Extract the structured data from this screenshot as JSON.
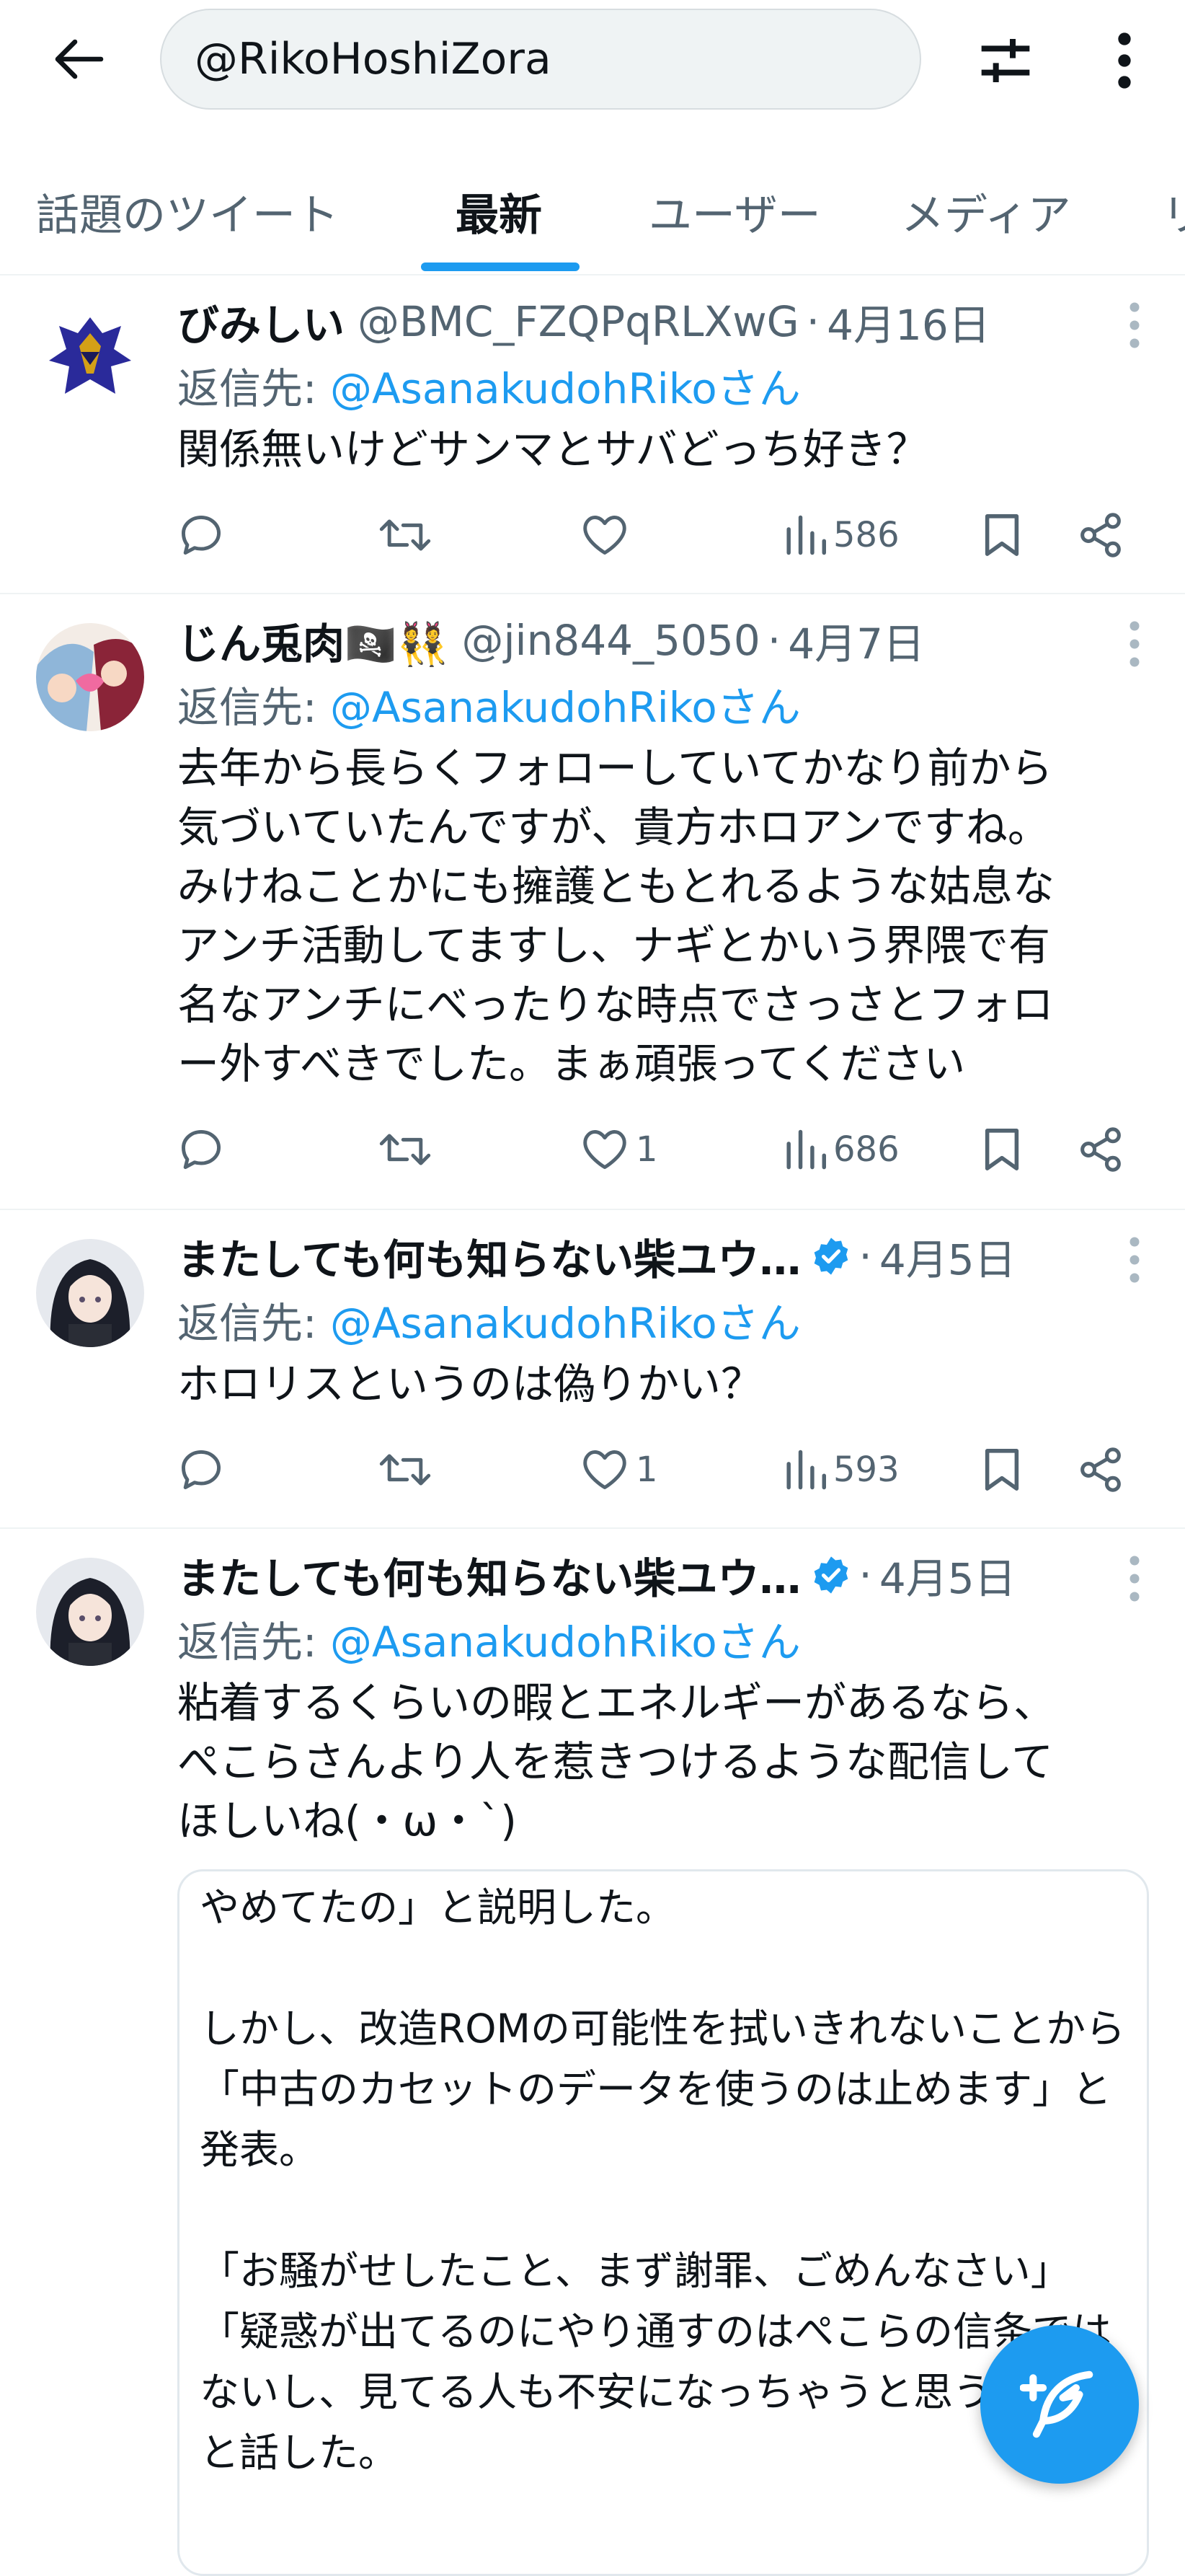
{
  "search": {
    "query": "@RikoHoshiZora"
  },
  "tabs": [
    {
      "label": "話題のツイート"
    },
    {
      "label": "最新"
    },
    {
      "label": "ユーザー"
    },
    {
      "label": "メディア"
    },
    {
      "label": "リ"
    }
  ],
  "active_tab": "最新",
  "colors": {
    "accent": "#1d9bf0",
    "text": "#0f1419",
    "secondary": "#536471"
  },
  "tweets": [
    {
      "name": "びみしい",
      "handle": "@BMC_FZQPqRLXwG",
      "sep": "·",
      "date": "4月16日",
      "reply_label": "返信先: ",
      "reply_to": "@AsanakudohRikoさん",
      "text": "関係無いけどサンマとサバどっち好き？",
      "likes": "",
      "views": "586"
    },
    {
      "name": "じん兎肉🏴‍☠️👯",
      "handle": "@jin844_5050",
      "sep": "·",
      "date": "4月7日",
      "reply_label": "返信先: ",
      "reply_to": "@AsanakudohRikoさん",
      "text": "去年から長らくフォローしていてかなり前から\n気づいていたんですが、貴方ホロアンですね。\nみけねことかにも擁護ともとれるような姑息な\nアンチ活動してますし、ナギとかいう界隈で有\n名なアンチにべったりな時点でさっさとフォロ\nー外すべきでした。まぁ頑張ってください",
      "likes": "1",
      "views": "686"
    },
    {
      "name": "またしても何も知らない柴ユウ…",
      "handle": "",
      "sep": "·",
      "date": "4月5日",
      "reply_label": "返信先: ",
      "reply_to": "@AsanakudohRikoさん",
      "text": "ホロリスというのは偽りかい？",
      "likes": "1",
      "views": "593"
    },
    {
      "name": "またしても何も知らない柴ユウ…",
      "handle": "",
      "sep": "·",
      "date": "4月5日",
      "reply_label": "返信先: ",
      "reply_to": "@AsanakudohRikoさん",
      "text": "粘着するくらいの暇とエネルギーがあるなら、\nぺこらさんより人を惹きつけるような配信して\nほしいね(・ω・`)",
      "quote_text": "やめてたの」と説明した。\n\nしかし、改造ROMの可能性を拭いきれないことから\n「中古のカセットのデータを使うのは止めます」と\n発表。\n\n「お騒がせしたこと、まず謝罪、ごめんなさい」\n「疑惑が出てるのにやり通すのはぺこらの信条では\nないし、見てる人も不安になっちゃうと思う」\nと話した。"
    }
  ],
  "icons": {
    "back": "arrow-left-icon",
    "filter": "sliders-icon",
    "more": "more-vertical-icon",
    "reply": "reply-icon",
    "retweet": "retweet-icon",
    "like": "heart-icon",
    "views": "views-bar-icon",
    "bookmark": "bookmark-icon",
    "share": "share-icon",
    "compose": "compose-feather-icon",
    "verified": "verified-badge-icon"
  }
}
